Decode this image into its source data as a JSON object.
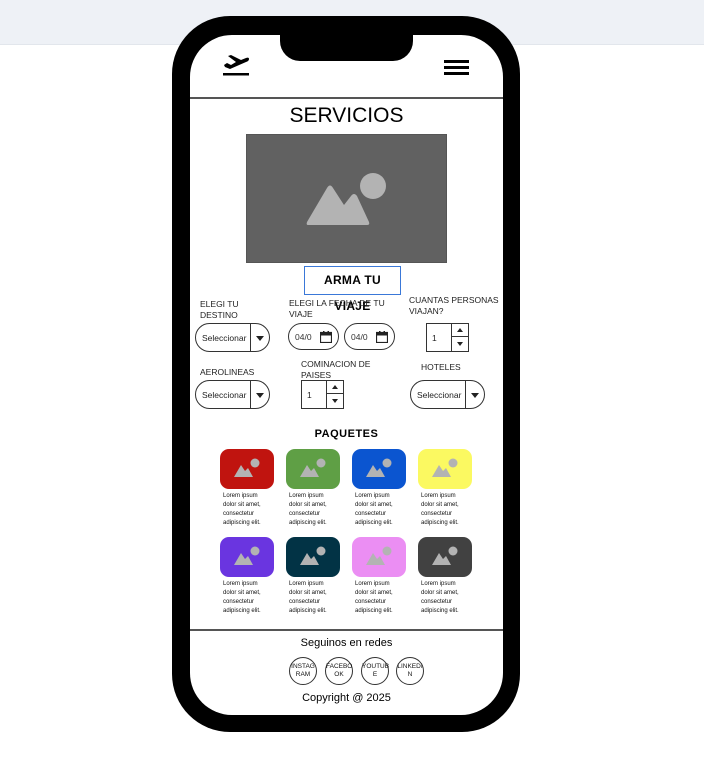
{
  "header": {
    "logo_icon": "airplane-takeoff-icon",
    "menu_icon": "hamburger-menu-icon"
  },
  "page": {
    "title": "SERVICIOS",
    "hero_icon": "image-placeholder-icon"
  },
  "builder": {
    "title": "ARMA TU VIAJE",
    "destino": {
      "label": "ELEGI TU DESTINO",
      "value": "Seleccionar"
    },
    "fecha": {
      "label": "ELEGI LA FECHA DE TU VIAJE",
      "start": "04/0",
      "end": "04/0"
    },
    "personas": {
      "label": "CUANTAS PERSONAS VIAJAN?",
      "value": "1"
    },
    "aerolineas": {
      "label": "AEROLINEAS",
      "value": "Seleccionar"
    },
    "paises": {
      "label": "COMINACION DE PAISES",
      "value": "1"
    },
    "hoteles": {
      "label": "HOTELES",
      "value": "Seleccionar"
    }
  },
  "paquetes": {
    "title": "PAQUETES",
    "items": [
      {
        "color": "#c0140f",
        "text": "Lorem ipsum dolor sit amet, consectetur adipiscing elit. Nulla quam"
      },
      {
        "color": "#5f9f45",
        "text": "Lorem ipsum dolor sit amet, consectetur adipiscing elit. Nulla quam"
      },
      {
        "color": "#0b55d0",
        "text": "Lorem ipsum dolor sit amet, consectetur adipiscing elit. Nulla quam"
      },
      {
        "color": "#fbf961",
        "text": "Lorem ipsum dolor sit amet, consectetur adipiscing elit. Nulla quam"
      },
      {
        "color": "#6a35e0",
        "text": "Lorem ipsum dolor sit amet, consectetur adipiscing elit. Nulla quam"
      },
      {
        "color": "#023345",
        "text": "Lorem ipsum dolor sit amet, consectetur adipiscing elit. Nulla quam"
      },
      {
        "color": "#eb8ef3",
        "text": "Lorem ipsum dolor sit amet, consectetur adipiscing elit. Nulla quam"
      },
      {
        "color": "#414141",
        "text": "Lorem ipsum dolor sit amet, consectetur adipiscing elit. Nulla quam"
      }
    ]
  },
  "footer": {
    "follow": "Seguinos en redes",
    "social": [
      "INSTAG RAM",
      "FACEBO OK",
      "YOUTUB E",
      "LINKEDI N"
    ],
    "copyright": "Copyright @ 2025"
  }
}
